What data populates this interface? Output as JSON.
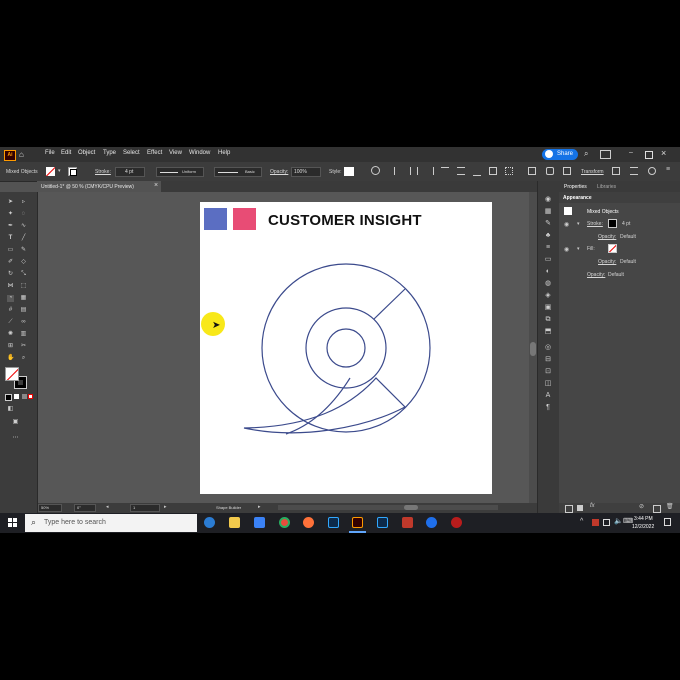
{
  "app": {
    "logo": "Ai"
  },
  "menu": [
    "File",
    "Edit",
    "Object",
    "Type",
    "Select",
    "Effect",
    "View",
    "Window",
    "Help"
  ],
  "share_label": "Share",
  "control_bar": {
    "selection": "Mixed Objects",
    "stroke_label": "Stroke:",
    "stroke_weight": "4 pt",
    "profile": "Uniform",
    "brush": "Basic",
    "opacity_label": "Opacity:",
    "opacity_value": "100%",
    "style_label": "Style:",
    "transform_label": "Transform"
  },
  "document_tab": {
    "title": "Untitled-1* @ 50 % (CMYK/CPU Preview)",
    "close": "×"
  },
  "artboard": {
    "title": "CUSTOMER INSIGHT",
    "swatch_colors": [
      "#5b6ec2",
      "#e84c75"
    ],
    "outline_color": "#3b4a8c"
  },
  "panel": {
    "tab_properties": "Properties",
    "tab_libraries": "Libraries",
    "section": "Appearance",
    "header": "Mixed Objects",
    "stroke_label": "Stroke:",
    "stroke_value": "4 pt",
    "opacity1_label": "Opacity:",
    "opacity1_value": "Default",
    "fill_label": "Fill:",
    "opacity2_label": "Opacity:",
    "opacity2_value": "Default",
    "opacity3_label": "Opacity:",
    "opacity3_value": "Default"
  },
  "status": {
    "zoom": "50%",
    "rotate": "0°",
    "artboard_num": "1",
    "tool_name": "Shape Builder"
  },
  "taskbar": {
    "search_placeholder": "Type here to search",
    "time": "3:44 PM",
    "date": "12/2/2022"
  }
}
